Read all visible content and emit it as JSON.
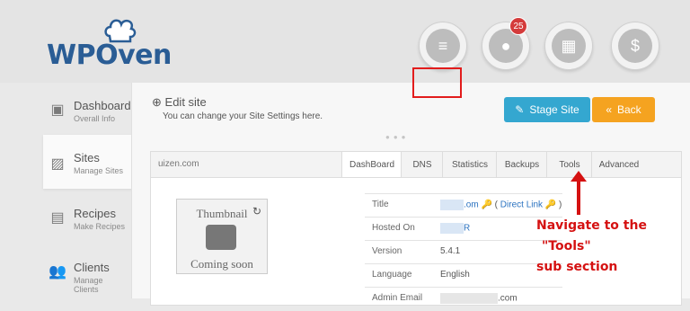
{
  "brand": {
    "name": "WPOven"
  },
  "top_icons": [
    {
      "icon": "coins-icon"
    },
    {
      "icon": "chat-icon",
      "badge": "25"
    },
    {
      "icon": "layout-icon"
    },
    {
      "icon": "dollar-icon"
    }
  ],
  "sidebar": {
    "items": [
      {
        "label": "Dashboard",
        "sub": "Overall Info",
        "icon": "presentation-icon"
      },
      {
        "label": "Sites",
        "sub": "Manage Sites",
        "icon": "image-icon"
      },
      {
        "label": "Recipes",
        "sub": "Make Recipes",
        "icon": "recipe-icon"
      },
      {
        "label": "Clients",
        "sub": "Manage Clients",
        "icon": "users-icon"
      }
    ]
  },
  "edit": {
    "title": "Edit site",
    "subtitle": "You can change your Site Settings here.",
    "stage_label": "Stage Site",
    "back_label": "Back"
  },
  "panel": {
    "site": "uizen.com",
    "tabs": [
      "DashBoard",
      "DNS",
      "Statistics",
      "Backups",
      "Tools",
      "Advanced"
    ]
  },
  "thumbnail": {
    "top": "Thumbnail",
    "bottom": "Coming soon"
  },
  "info": [
    {
      "label": "Title",
      "value_prefix": ".om",
      "link": "Direct Link"
    },
    {
      "label": "Hosted On",
      "value": "R"
    },
    {
      "label": "Version",
      "value": "5.4.1"
    },
    {
      "label": "Language",
      "value": "English"
    },
    {
      "label": "Admin Email",
      "value": ".com"
    }
  ],
  "annotation": {
    "line1": "Navigate to the",
    "line2": "\"Tools\"",
    "line3": "sub section",
    "color": "#d51111"
  }
}
